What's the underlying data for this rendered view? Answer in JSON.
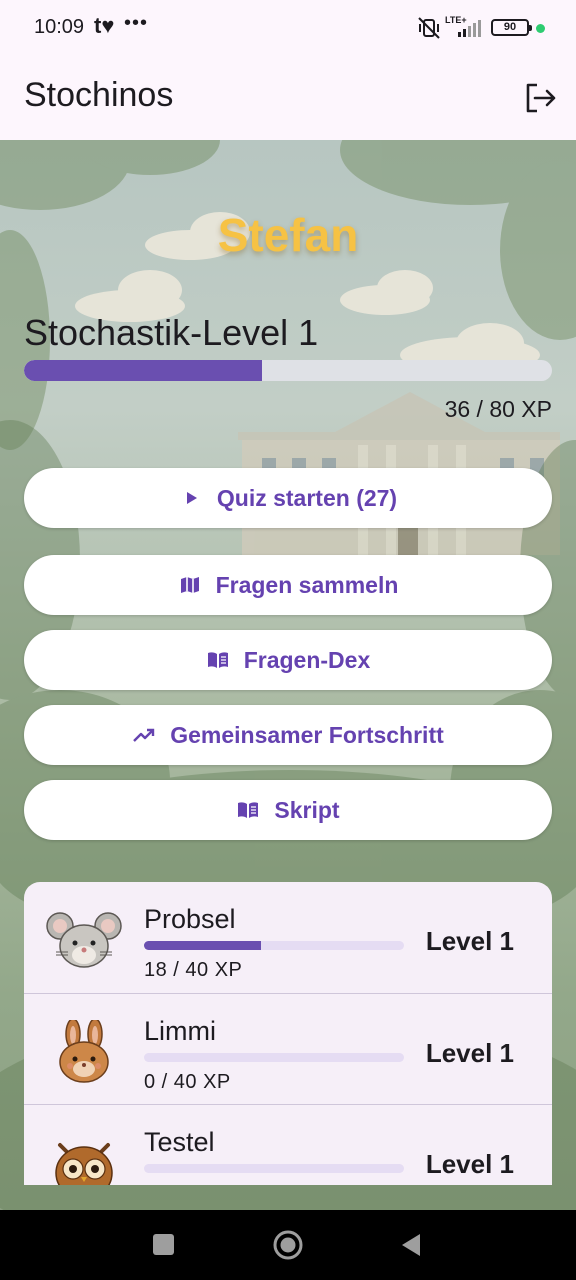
{
  "status_bar": {
    "time": "10:09",
    "app_glyph": "t♥",
    "more": "•••",
    "network": "LTE+",
    "battery": "90",
    "accent": "#2ecc71"
  },
  "app_bar": {
    "title": "Stochinos",
    "logout_icon": "logout-icon"
  },
  "profile": {
    "username": "Stefan",
    "level_title": "Stochastik-Level 1",
    "xp_current": 36,
    "xp_max": 80,
    "xp_text": "36 / 80 XP"
  },
  "actions": [
    {
      "label": "Quiz starten (27)",
      "icon": "play-icon"
    },
    {
      "label": "Fragen sammeln",
      "icon": "map-icon"
    },
    {
      "label": "Fragen-Dex",
      "icon": "book-icon"
    },
    {
      "label": "Gemeinsamer Fortschritt",
      "icon": "trending-up-icon"
    },
    {
      "label": "Skript",
      "icon": "book-icon"
    }
  ],
  "pets": [
    {
      "name": "Probsel",
      "xp_current": 18,
      "xp_max": 40,
      "xp_text": "18 / 40 XP",
      "level": "Level 1",
      "avatar": "mouse-avatar"
    },
    {
      "name": "Limmi",
      "xp_current": 0,
      "xp_max": 40,
      "xp_text": "0 / 40 XP",
      "level": "Level 1",
      "avatar": "rabbit-avatar"
    },
    {
      "name": "Testel",
      "xp_current": 0,
      "xp_max": 40,
      "xp_text": "",
      "level": "Level 1",
      "avatar": "owl-avatar"
    }
  ],
  "colors": {
    "primary": "#6542b0",
    "progress": "#6a4fb0",
    "username": "#f6c244",
    "surface": "#fdf6fd"
  }
}
